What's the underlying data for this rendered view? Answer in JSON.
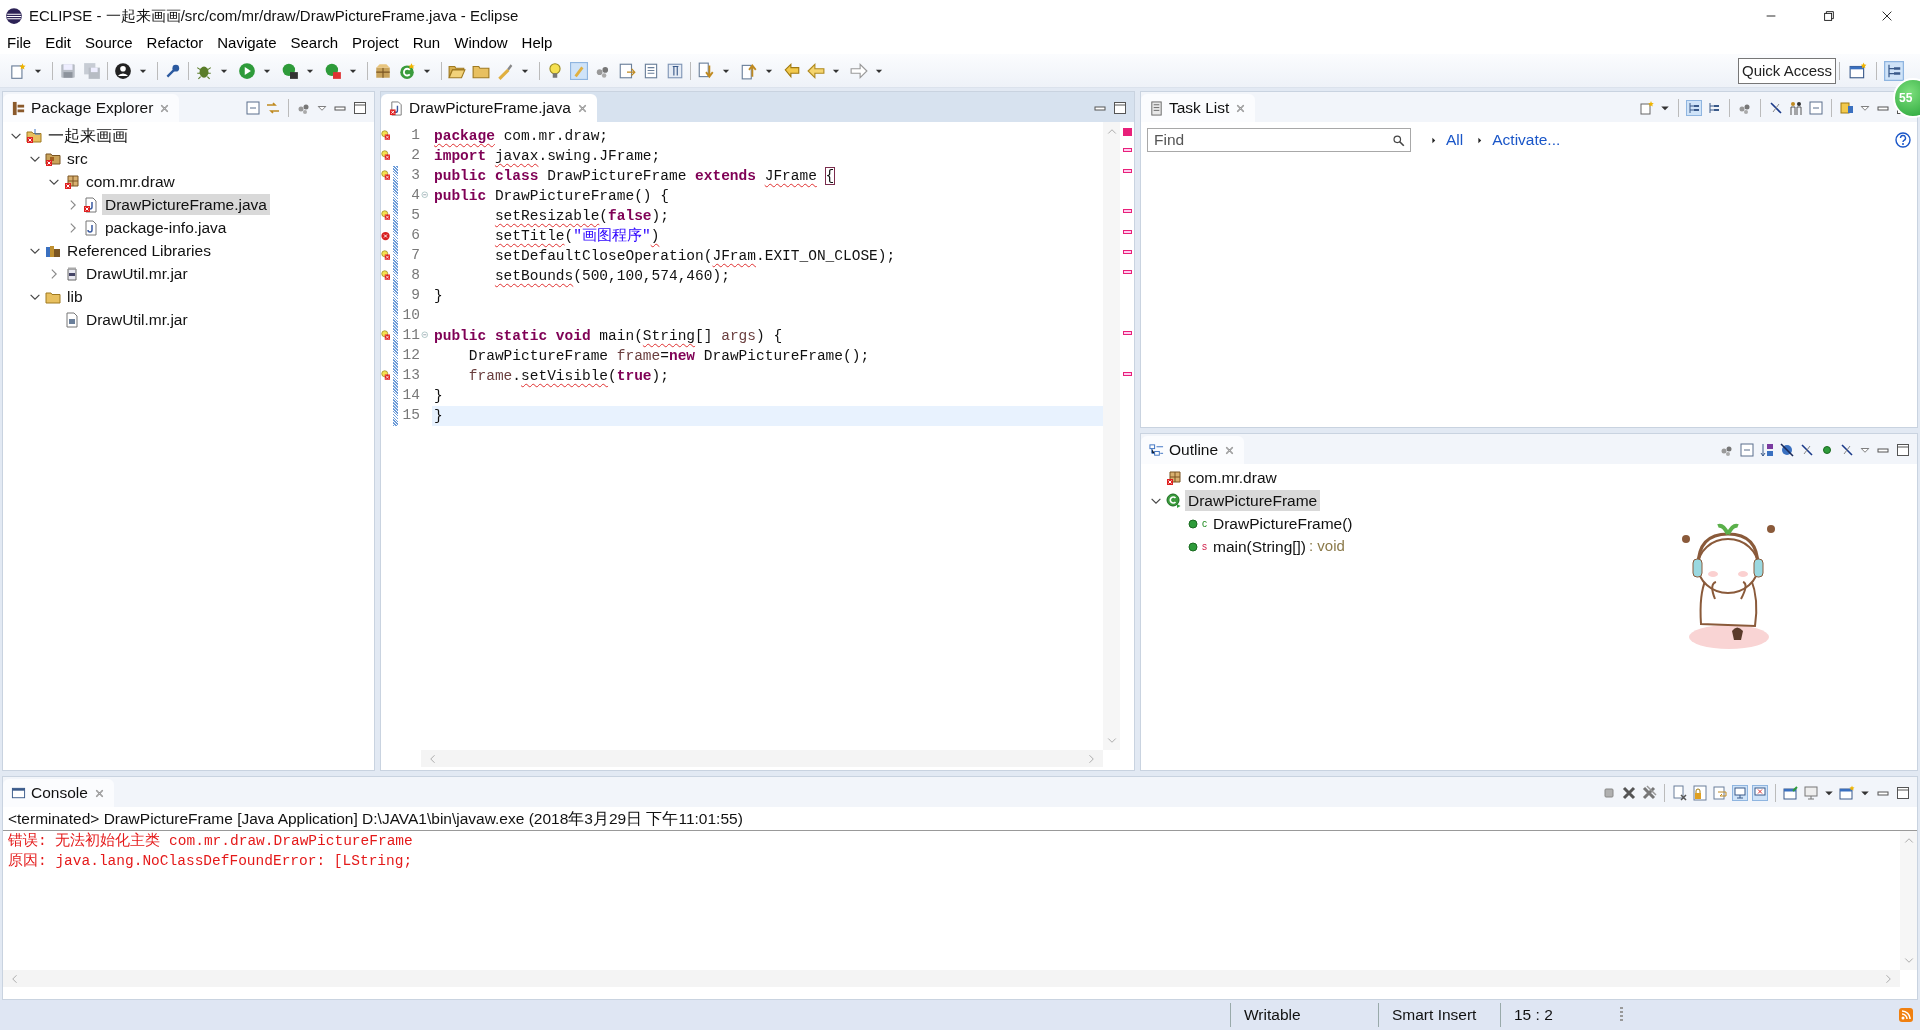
{
  "window": {
    "title": "ECLIPSE - 一起来画画/src/com/mr/draw/DrawPictureFrame.java - Eclipse"
  },
  "menu": [
    "File",
    "Edit",
    "Source",
    "Refactor",
    "Navigate",
    "Search",
    "Project",
    "Run",
    "Window",
    "Help"
  ],
  "quick_access": {
    "placeholder": "Quick Access"
  },
  "floating_badge": "55",
  "package_explorer": {
    "title": "Package Explorer",
    "tree": [
      {
        "label": "一起来画画",
        "kind": "project",
        "expanded": true,
        "selected": false,
        "children": [
          {
            "label": "src",
            "kind": "src",
            "expanded": true,
            "selected": false,
            "children": [
              {
                "label": "com.mr.draw",
                "kind": "package",
                "expanded": true,
                "selected": false,
                "children": [
                  {
                    "label": "DrawPictureFrame.java",
                    "kind": "java-error",
                    "expanded": false,
                    "selected": true
                  },
                  {
                    "label": "package-info.java",
                    "kind": "java",
                    "expanded": false,
                    "selected": false
                  }
                ]
              }
            ]
          },
          {
            "label": "Referenced Libraries",
            "kind": "libraries",
            "expanded": true,
            "selected": false,
            "children": [
              {
                "label": "DrawUtil.mr.jar",
                "kind": "jar",
                "expanded": false,
                "selected": false
              }
            ]
          },
          {
            "label": "lib",
            "kind": "folder",
            "expanded": true,
            "selected": false,
            "children": [
              {
                "label": "DrawUtil.mr.jar",
                "kind": "jar-file",
                "selected": false
              }
            ]
          }
        ]
      }
    ]
  },
  "editor": {
    "tab": "DrawPictureFrame.java",
    "lines": [
      {
        "number": "1",
        "quick_fix": true,
        "error": false,
        "fold": false,
        "changed": false,
        "current": false,
        "segments": [
          {
            "text": "package",
            "kind": "keyword-error"
          },
          {
            "text": " com.mr.draw;",
            "kind": "plain"
          }
        ]
      },
      {
        "number": "2",
        "quick_fix": true,
        "error": false,
        "fold": false,
        "changed": false,
        "current": false,
        "segments": [
          {
            "text": "import",
            "kind": "keyword"
          },
          {
            "text": " javax",
            "kind": "error"
          },
          {
            "text": ".swing.JFrame;",
            "kind": "plain"
          }
        ]
      },
      {
        "number": "3",
        "quick_fix": true,
        "error": false,
        "fold": false,
        "changed": true,
        "current": false,
        "segments": [
          {
            "text": "public class",
            "kind": "keyword"
          },
          {
            "text": " DrawPictureFrame ",
            "kind": "plain"
          },
          {
            "text": "extends",
            "kind": "keyword"
          },
          {
            "text": " JFrame",
            "kind": "error"
          },
          {
            "text": " {",
            "kind": "bracket"
          }
        ]
      },
      {
        "number": "4",
        "quick_fix": false,
        "error": false,
        "fold": true,
        "changed": true,
        "current": false,
        "segments": [
          {
            "text": "public",
            "kind": "keyword"
          },
          {
            "text": " DrawPictureFrame() {",
            "kind": "plain"
          }
        ]
      },
      {
        "number": "5",
        "quick_fix": true,
        "error": false,
        "fold": false,
        "changed": true,
        "current": false,
        "segments": [
          {
            "text": "       setResizable",
            "kind": "error"
          },
          {
            "text": "(",
            "kind": "plain"
          },
          {
            "text": "false",
            "kind": "keyword"
          },
          {
            "text": ");",
            "kind": "plain"
          }
        ]
      },
      {
        "number": "6",
        "quick_fix": false,
        "error": true,
        "fold": false,
        "changed": true,
        "current": false,
        "segments": [
          {
            "text": "       setTitle",
            "kind": "error"
          },
          {
            "text": "(",
            "kind": "plain"
          },
          {
            "text": "\"画图程序\"",
            "kind": "string"
          },
          {
            "text": ")",
            "kind": "error"
          }
        ]
      },
      {
        "number": "7",
        "quick_fix": true,
        "error": false,
        "fold": false,
        "changed": true,
        "current": false,
        "segments": [
          {
            "text": "       setDefaultCloseOperation(",
            "kind": "plain"
          },
          {
            "text": "JFram",
            "kind": "error"
          },
          {
            "text": ".EXIT_ON_CLOSE);",
            "kind": "plain"
          }
        ]
      },
      {
        "number": "8",
        "quick_fix": true,
        "error": false,
        "fold": false,
        "changed": true,
        "current": false,
        "segments": [
          {
            "text": "       setBounds",
            "kind": "error"
          },
          {
            "text": "(500,100,574,460);",
            "kind": "plain"
          }
        ]
      },
      {
        "number": "9",
        "quick_fix": false,
        "error": false,
        "fold": false,
        "changed": true,
        "current": false,
        "segments": [
          {
            "text": "}",
            "kind": "plain"
          }
        ]
      },
      {
        "number": "10",
        "quick_fix": false,
        "error": false,
        "fold": false,
        "changed": true,
        "current": false
      },
      {
        "number": "11",
        "quick_fix": true,
        "error": false,
        "fold": true,
        "changed": true,
        "current": false,
        "segments": [
          {
            "text": "public static void",
            "kind": "keyword"
          },
          {
            "text": " main(",
            "kind": "plain"
          },
          {
            "text": "String",
            "kind": "error"
          },
          {
            "text": "[] ",
            "kind": "plain"
          },
          {
            "text": "args",
            "kind": "variable"
          },
          {
            "text": ") {",
            "kind": "plain"
          }
        ]
      },
      {
        "number": "12",
        "quick_fix": false,
        "error": false,
        "fold": false,
        "changed": true,
        "current": false,
        "segments": [
          {
            "text": "    DrawPictureFrame ",
            "kind": "plain"
          },
          {
            "text": "frame",
            "kind": "variable"
          },
          {
            "text": "=",
            "kind": "plain"
          },
          {
            "text": "new",
            "kind": "keyword"
          },
          {
            "text": " DrawPictureFrame();",
            "kind": "plain"
          }
        ]
      },
      {
        "number": "13",
        "quick_fix": true,
        "error": false,
        "fold": false,
        "changed": true,
        "current": false,
        "segments": [
          {
            "text": "    frame",
            "kind": "variable"
          },
          {
            "text": ".",
            "kind": "plain"
          },
          {
            "text": "setVisible",
            "kind": "error"
          },
          {
            "text": "(",
            "kind": "plain"
          },
          {
            "text": "true",
            "kind": "keyword"
          },
          {
            "text": ");",
            "kind": "plain"
          }
        ]
      },
      {
        "number": "14",
        "quick_fix": false,
        "error": false,
        "fold": false,
        "changed": true,
        "current": false,
        "segments": [
          {
            "text": "}",
            "kind": "plain"
          }
        ]
      },
      {
        "number": "15",
        "quick_fix": false,
        "error": false,
        "fold": false,
        "changed": true,
        "current": true,
        "segments": [
          {
            "text": "}",
            "kind": "plain"
          }
        ]
      }
    ]
  },
  "task_list": {
    "title": "Task List",
    "find": {
      "placeholder": "Find"
    },
    "links": [
      "All",
      "Activate..."
    ]
  },
  "outline": {
    "title": "Outline",
    "items": [
      {
        "label": "com.mr.draw",
        "kind": "package",
        "selected": false
      },
      {
        "label": "DrawPictureFrame",
        "kind": "class",
        "expanded": true,
        "selected": true,
        "children": [
          {
            "label": "DrawPictureFrame()",
            "kind": "method",
            "modifier": "c",
            "selected": false
          },
          {
            "label": "main(String[])",
            "kind": "method",
            "modifier": "s",
            "type": ": void",
            "selected": false
          }
        ]
      }
    ]
  },
  "console": {
    "title": "Console",
    "header": "<terminated> DrawPictureFrame [Java Application] D:\\JAVA1\\bin\\javaw.exe (2018年3月29日 下午11:01:55)",
    "output": [
      {
        "text": "错误: 无法初始化主类 com.mr.draw.DrawPictureFrame",
        "kind": "error"
      },
      {
        "text": "原因: java.lang.NoClassDefFoundError: [LString;",
        "kind": "error"
      }
    ]
  },
  "status_bar": [
    "Writable",
    "Smart Insert",
    "15 : 2"
  ]
}
